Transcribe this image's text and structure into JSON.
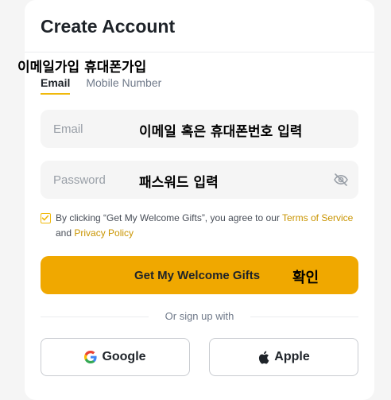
{
  "header": {
    "title": "Create Account"
  },
  "annotations": {
    "tabs_kr": "이메일가입  휴대폰가입",
    "email_kr": "이메일 혹은 휴대폰번호 입력",
    "password_kr": "패스워드 입력",
    "confirm_kr": "확인"
  },
  "tabs": [
    {
      "label": "Email",
      "active": true
    },
    {
      "label": "Mobile Number",
      "active": false
    }
  ],
  "form": {
    "email_placeholder": "Email",
    "password_placeholder": "Password",
    "terms_prefix": "By clicking “Get My Welcome Gifts”, you agree to our ",
    "terms_link": "Terms of Service",
    "terms_and": " and ",
    "privacy_link": "Privacy Policy",
    "terms_checked": true,
    "submit_label": "Get My Welcome Gifts"
  },
  "social": {
    "divider_text": "Or sign up with",
    "google_label": "Google",
    "apple_label": "Apple"
  },
  "colors": {
    "accent": "#f0b90b",
    "button": "#f0a800",
    "link": "#c99400"
  },
  "icons": {
    "password_toggle": "eye-off-icon",
    "checkbox": "checkmark-icon",
    "google": "google-icon",
    "apple": "apple-icon"
  }
}
